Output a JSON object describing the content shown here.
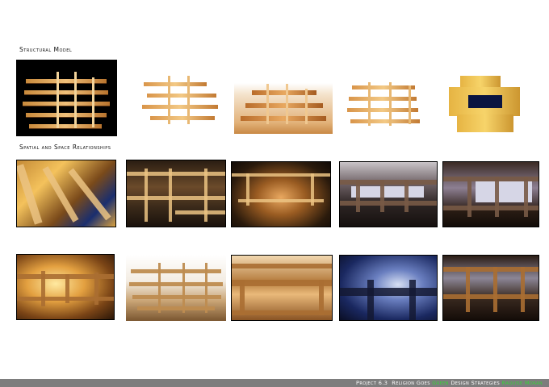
{
  "sections": {
    "structural_title": "Structural Model",
    "spatial_title": "Spatial and Space Relationships"
  },
  "footer": {
    "project": "Project 6.3",
    "title_part1": "Religion Goes",
    "title_green": "Green",
    "title_part2": "Design Strategies",
    "author": "Raquise Moran"
  },
  "colors": {
    "footer_bar": "#7d7d7d",
    "footer_text": "#ffffff",
    "accent_green": "#35d635"
  }
}
